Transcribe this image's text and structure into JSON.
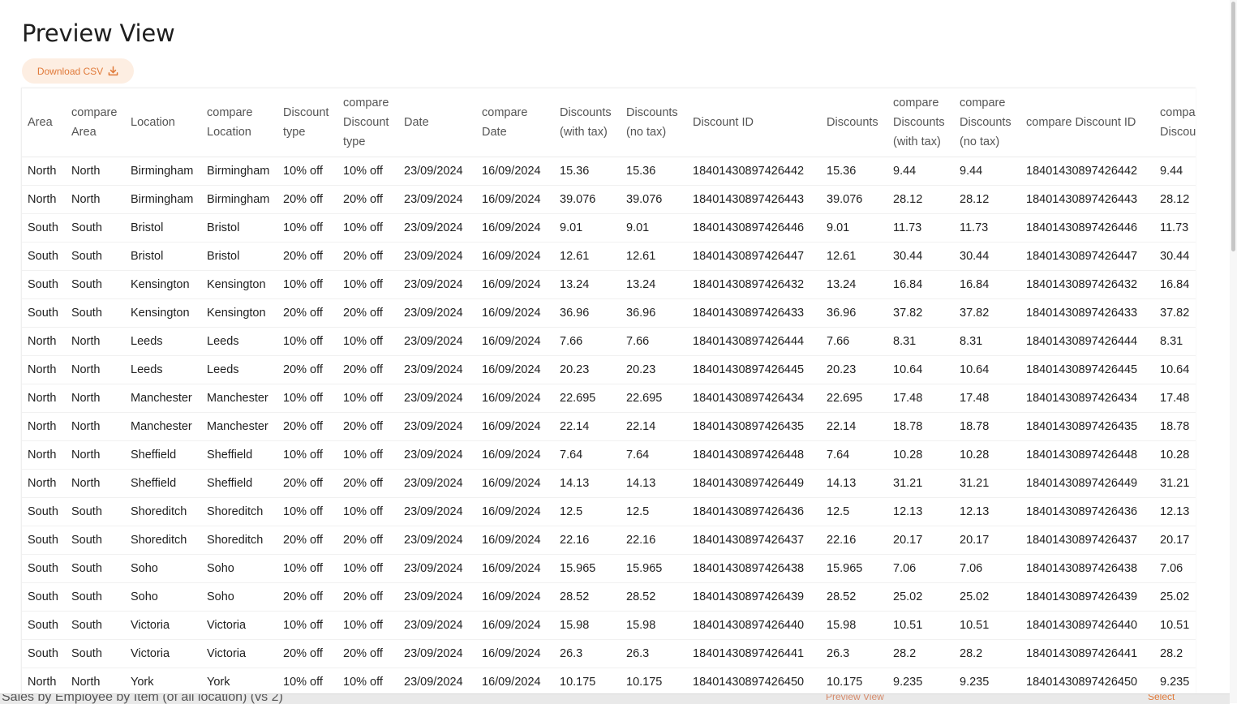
{
  "page": {
    "title": "Preview View"
  },
  "toolbar": {
    "download_label": "Download CSV"
  },
  "table": {
    "columns": [
      [
        "Area"
      ],
      [
        "compare",
        "Area"
      ],
      [
        "Location"
      ],
      [
        "compare",
        "Location"
      ],
      [
        "Discount",
        "type"
      ],
      [
        "compare",
        "Discount",
        "type"
      ],
      [
        "Date"
      ],
      [
        "compare",
        "Date"
      ],
      [
        "Discounts",
        "(with tax)"
      ],
      [
        "Discounts",
        "(no tax)"
      ],
      [
        "Discount ID"
      ],
      [
        "Discounts"
      ],
      [
        "compare",
        "Discounts",
        "(with tax)"
      ],
      [
        "compare",
        "Discounts",
        "(no tax)"
      ],
      [
        "compare Discount ID"
      ],
      [
        "compare",
        "Discou"
      ]
    ],
    "rows": [
      [
        "North",
        "North",
        "Birmingham",
        "Birmingham",
        "10% off",
        "10% off",
        "23/09/2024",
        "16/09/2024",
        "15.36",
        "15.36",
        "18401430897426442",
        "15.36",
        "9.44",
        "9.44",
        "18401430897426442",
        "9.44"
      ],
      [
        "North",
        "North",
        "Birmingham",
        "Birmingham",
        "20% off",
        "20% off",
        "23/09/2024",
        "16/09/2024",
        "39.076",
        "39.076",
        "18401430897426443",
        "39.076",
        "28.12",
        "28.12",
        "18401430897426443",
        "28.12"
      ],
      [
        "South",
        "South",
        "Bristol",
        "Bristol",
        "10% off",
        "10% off",
        "23/09/2024",
        "16/09/2024",
        "9.01",
        "9.01",
        "18401430897426446",
        "9.01",
        "11.73",
        "11.73",
        "18401430897426446",
        "11.73"
      ],
      [
        "South",
        "South",
        "Bristol",
        "Bristol",
        "20% off",
        "20% off",
        "23/09/2024",
        "16/09/2024",
        "12.61",
        "12.61",
        "18401430897426447",
        "12.61",
        "30.44",
        "30.44",
        "18401430897426447",
        "30.44"
      ],
      [
        "South",
        "South",
        "Kensington",
        "Kensington",
        "10% off",
        "10% off",
        "23/09/2024",
        "16/09/2024",
        "13.24",
        "13.24",
        "18401430897426432",
        "13.24",
        "16.84",
        "16.84",
        "18401430897426432",
        "16.84"
      ],
      [
        "South",
        "South",
        "Kensington",
        "Kensington",
        "20% off",
        "20% off",
        "23/09/2024",
        "16/09/2024",
        "36.96",
        "36.96",
        "18401430897426433",
        "36.96",
        "37.82",
        "37.82",
        "18401430897426433",
        "37.82"
      ],
      [
        "North",
        "North",
        "Leeds",
        "Leeds",
        "10% off",
        "10% off",
        "23/09/2024",
        "16/09/2024",
        "7.66",
        "7.66",
        "18401430897426444",
        "7.66",
        "8.31",
        "8.31",
        "18401430897426444",
        "8.31"
      ],
      [
        "North",
        "North",
        "Leeds",
        "Leeds",
        "20% off",
        "20% off",
        "23/09/2024",
        "16/09/2024",
        "20.23",
        "20.23",
        "18401430897426445",
        "20.23",
        "10.64",
        "10.64",
        "18401430897426445",
        "10.64"
      ],
      [
        "North",
        "North",
        "Manchester",
        "Manchester",
        "10% off",
        "10% off",
        "23/09/2024",
        "16/09/2024",
        "22.695",
        "22.695",
        "18401430897426434",
        "22.695",
        "17.48",
        "17.48",
        "18401430897426434",
        "17.48"
      ],
      [
        "North",
        "North",
        "Manchester",
        "Manchester",
        "20% off",
        "20% off",
        "23/09/2024",
        "16/09/2024",
        "22.14",
        "22.14",
        "18401430897426435",
        "22.14",
        "18.78",
        "18.78",
        "18401430897426435",
        "18.78"
      ],
      [
        "North",
        "North",
        "Sheffield",
        "Sheffield",
        "10% off",
        "10% off",
        "23/09/2024",
        "16/09/2024",
        "7.64",
        "7.64",
        "18401430897426448",
        "7.64",
        "10.28",
        "10.28",
        "18401430897426448",
        "10.28"
      ],
      [
        "North",
        "North",
        "Sheffield",
        "Sheffield",
        "20% off",
        "20% off",
        "23/09/2024",
        "16/09/2024",
        "14.13",
        "14.13",
        "18401430897426449",
        "14.13",
        "31.21",
        "31.21",
        "18401430897426449",
        "31.21"
      ],
      [
        "South",
        "South",
        "Shoreditch",
        "Shoreditch",
        "10% off",
        "10% off",
        "23/09/2024",
        "16/09/2024",
        "12.5",
        "12.5",
        "18401430897426436",
        "12.5",
        "12.13",
        "12.13",
        "18401430897426436",
        "12.13"
      ],
      [
        "South",
        "South",
        "Shoreditch",
        "Shoreditch",
        "20% off",
        "20% off",
        "23/09/2024",
        "16/09/2024",
        "22.16",
        "22.16",
        "18401430897426437",
        "22.16",
        "20.17",
        "20.17",
        "18401430897426437",
        "20.17"
      ],
      [
        "South",
        "South",
        "Soho",
        "Soho",
        "10% off",
        "10% off",
        "23/09/2024",
        "16/09/2024",
        "15.965",
        "15.965",
        "18401430897426438",
        "15.965",
        "7.06",
        "7.06",
        "18401430897426438",
        "7.06"
      ],
      [
        "South",
        "South",
        "Soho",
        "Soho",
        "20% off",
        "20% off",
        "23/09/2024",
        "16/09/2024",
        "28.52",
        "28.52",
        "18401430897426439",
        "28.52",
        "25.02",
        "25.02",
        "18401430897426439",
        "25.02"
      ],
      [
        "South",
        "South",
        "Victoria",
        "Victoria",
        "10% off",
        "10% off",
        "23/09/2024",
        "16/09/2024",
        "15.98",
        "15.98",
        "18401430897426440",
        "15.98",
        "10.51",
        "10.51",
        "18401430897426440",
        "10.51"
      ],
      [
        "South",
        "South",
        "Victoria",
        "Victoria",
        "20% off",
        "20% off",
        "23/09/2024",
        "16/09/2024",
        "26.3",
        "26.3",
        "18401430897426441",
        "26.3",
        "28.2",
        "28.2",
        "18401430897426441",
        "28.2"
      ],
      [
        "North",
        "North",
        "York",
        "York",
        "10% off",
        "10% off",
        "23/09/2024",
        "16/09/2024",
        "10.175",
        "10.175",
        "18401430897426450",
        "10.175",
        "9.235",
        "9.235",
        "18401430897426450",
        "9.235"
      ]
    ]
  },
  "background_peek": {
    "text": "Sales by Employee by Item (of all location) (vs 2)",
    "mid_text": "Preview View",
    "right_text": "Select"
  },
  "colors": {
    "accent": "#e07a3a",
    "accent_bg": "#fdeee2",
    "text": "#1f1f1f",
    "header_text": "#555555"
  },
  "icons": {
    "download": "download-icon"
  }
}
